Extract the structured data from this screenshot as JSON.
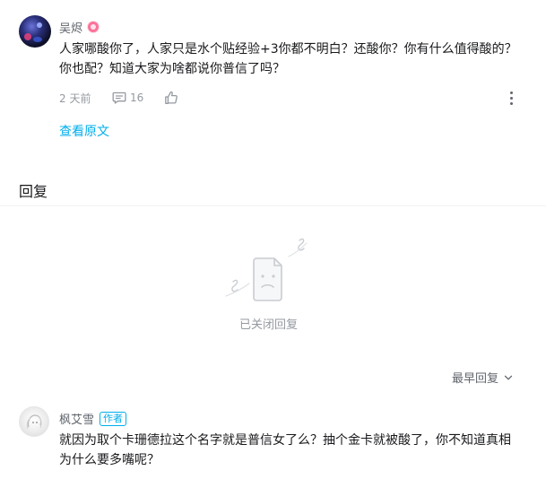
{
  "comment1": {
    "username": "吴烬",
    "text_line1": "人家哪酸你了，人家只是水个贴经验+3你都不明白？还酸你？你有什么值得酸的？",
    "text_line2": "你也配？知道大家为啥都说你普信了吗？",
    "time": "2 天前",
    "reply_count": "16",
    "view_original": "查看原文",
    "icons": [
      "level-badge-icon",
      "comment-icon",
      "like-icon",
      "more-icon"
    ]
  },
  "replies_section": {
    "title": "回复",
    "empty_state": "已关闭回复",
    "sort_label": "最早回复",
    "sort_icon": "chevron-down-icon"
  },
  "comment2": {
    "username": "枫艾雪",
    "author_tag": "作者",
    "text_line1": "就因为取个卡珊德拉这个名字就是普信女了么？抽个金卡就被酸了，你不知道真相",
    "text_line2": "为什么要多嘴呢？"
  },
  "colors": {
    "accent": "#00aeec",
    "badge_pink": "#fb7299",
    "meta_gray": "#9499a0"
  }
}
